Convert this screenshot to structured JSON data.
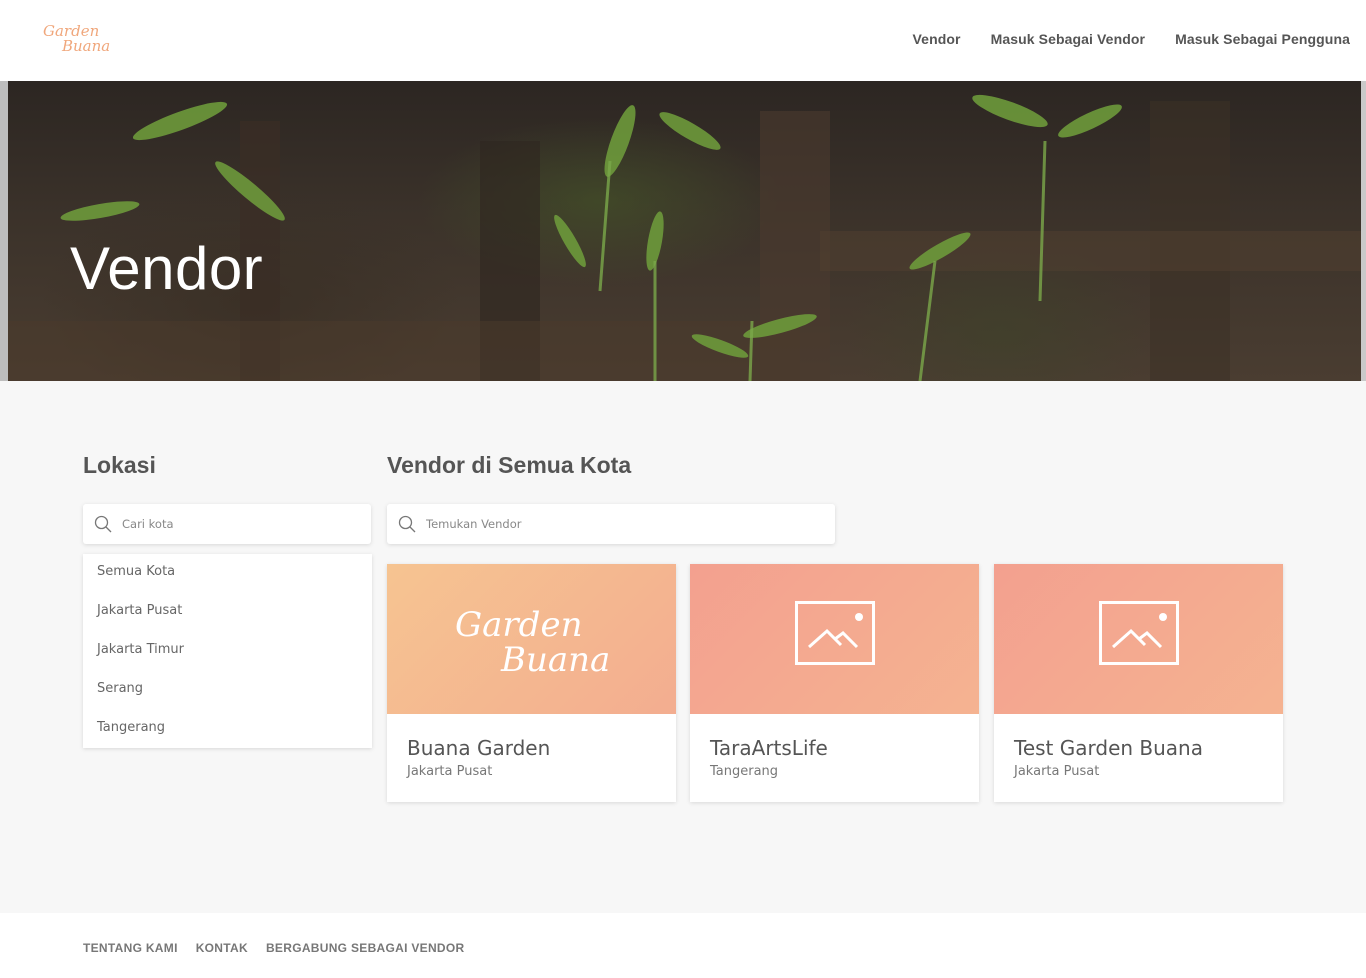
{
  "brand": {
    "line1": "Garden",
    "line2": "Buana"
  },
  "nav": {
    "items": [
      "Vendor",
      "Masuk Sebagai Vendor",
      "Masuk Sebagai Pengguna"
    ]
  },
  "hero": {
    "title": "Vendor"
  },
  "location": {
    "heading": "Lokasi",
    "search_placeholder": "Cari kota",
    "cities": [
      "Semua Kota",
      "Jakarta Pusat",
      "Jakarta Timur",
      "Serang",
      "Tangerang"
    ]
  },
  "vendors": {
    "heading": "Vendor di Semua Kota",
    "search_placeholder": "Temukan Vendor",
    "cards": [
      {
        "name": "Buana Garden",
        "city": "Jakarta Pusat",
        "image": "garden-buana-logo"
      },
      {
        "name": "TaraArtsLife",
        "city": "Tangerang",
        "image": "image-placeholder-icon"
      },
      {
        "name": "Test Garden Buana",
        "city": "Jakarta Pusat",
        "image": "image-placeholder-icon"
      }
    ]
  },
  "footer": {
    "links": [
      "TENTANG KAMI",
      "KONTAK",
      "BERGABUNG SEBAGAI VENDOR"
    ]
  },
  "colors": {
    "brand_peach": "#f0a77c",
    "card_gradient_start": "#f6c491",
    "card_gradient_end": "#f3a08f",
    "text": "#555555",
    "background": "#f7f7f7"
  }
}
